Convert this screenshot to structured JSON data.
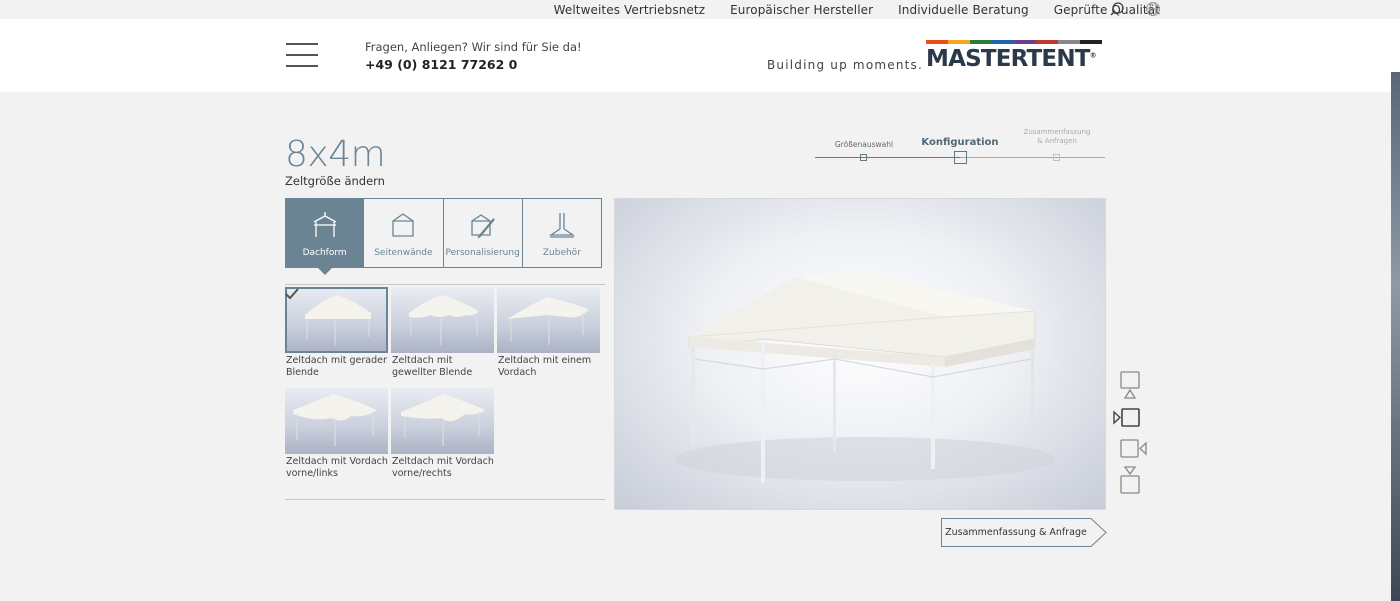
{
  "topbar": {
    "links": [
      "Weltweites Vertriebsnetz",
      "Europäischer Hersteller",
      "Individuelle Beratung",
      "Geprüfte Qualität"
    ],
    "icons": [
      "search-icon",
      "globe-icon"
    ]
  },
  "header": {
    "contact_question": "Fragen, Anliegen? Wir sind für Sie da!",
    "contact_phone": "+49 (0) 8121 77262 0",
    "slogan": "Building up moments.",
    "logo_text": "MASTERTENT",
    "logo_mark": "®",
    "logo_colors": [
      "#e94e1b",
      "#f5a623",
      "#2d7a3a",
      "#1d64a8",
      "#6c3e8f",
      "#c0392b",
      "#888888",
      "#222222"
    ]
  },
  "config": {
    "size": "8x4m",
    "size_change_label": "Zeltgröße ändern"
  },
  "progress": {
    "steps": [
      {
        "label": "Größenauswahl",
        "state": "done"
      },
      {
        "label": "Konfiguration",
        "state": "active"
      },
      {
        "label_line1": "Zusammenfassung",
        "label_line2": "& Anfragen",
        "state": "upcoming"
      }
    ]
  },
  "tabs": [
    {
      "label": "Dachform",
      "icon": "roof-icon",
      "active": true
    },
    {
      "label": "Seitenwände",
      "icon": "side-walls-icon",
      "active": false
    },
    {
      "label": "Personalisierung",
      "icon": "personalization-icon",
      "active": false
    },
    {
      "label": "Zubehör",
      "icon": "accessories-icon",
      "active": false
    }
  ],
  "options": [
    {
      "label": "Zeltdach mit gerader\nBlende",
      "selected": true
    },
    {
      "label": "Zeltdach mit\ngewellter Blende",
      "selected": false
    },
    {
      "label": "Zeltdach mit einem\nVordach",
      "selected": false
    },
    {
      "label": "Zeltdach mit Vordach\nvorne/links",
      "selected": false
    },
    {
      "label": "Zeltdach mit Vordach\nvorne/rechts",
      "selected": false
    }
  ],
  "view_icons": [
    "view-front-icon",
    "view-left-icon",
    "view-right-icon",
    "view-back-icon"
  ],
  "cta": {
    "label": "Zusammenfassung & Anfrage"
  },
  "colors": {
    "accent": "#6b8494",
    "background": "#f2f2f2"
  }
}
